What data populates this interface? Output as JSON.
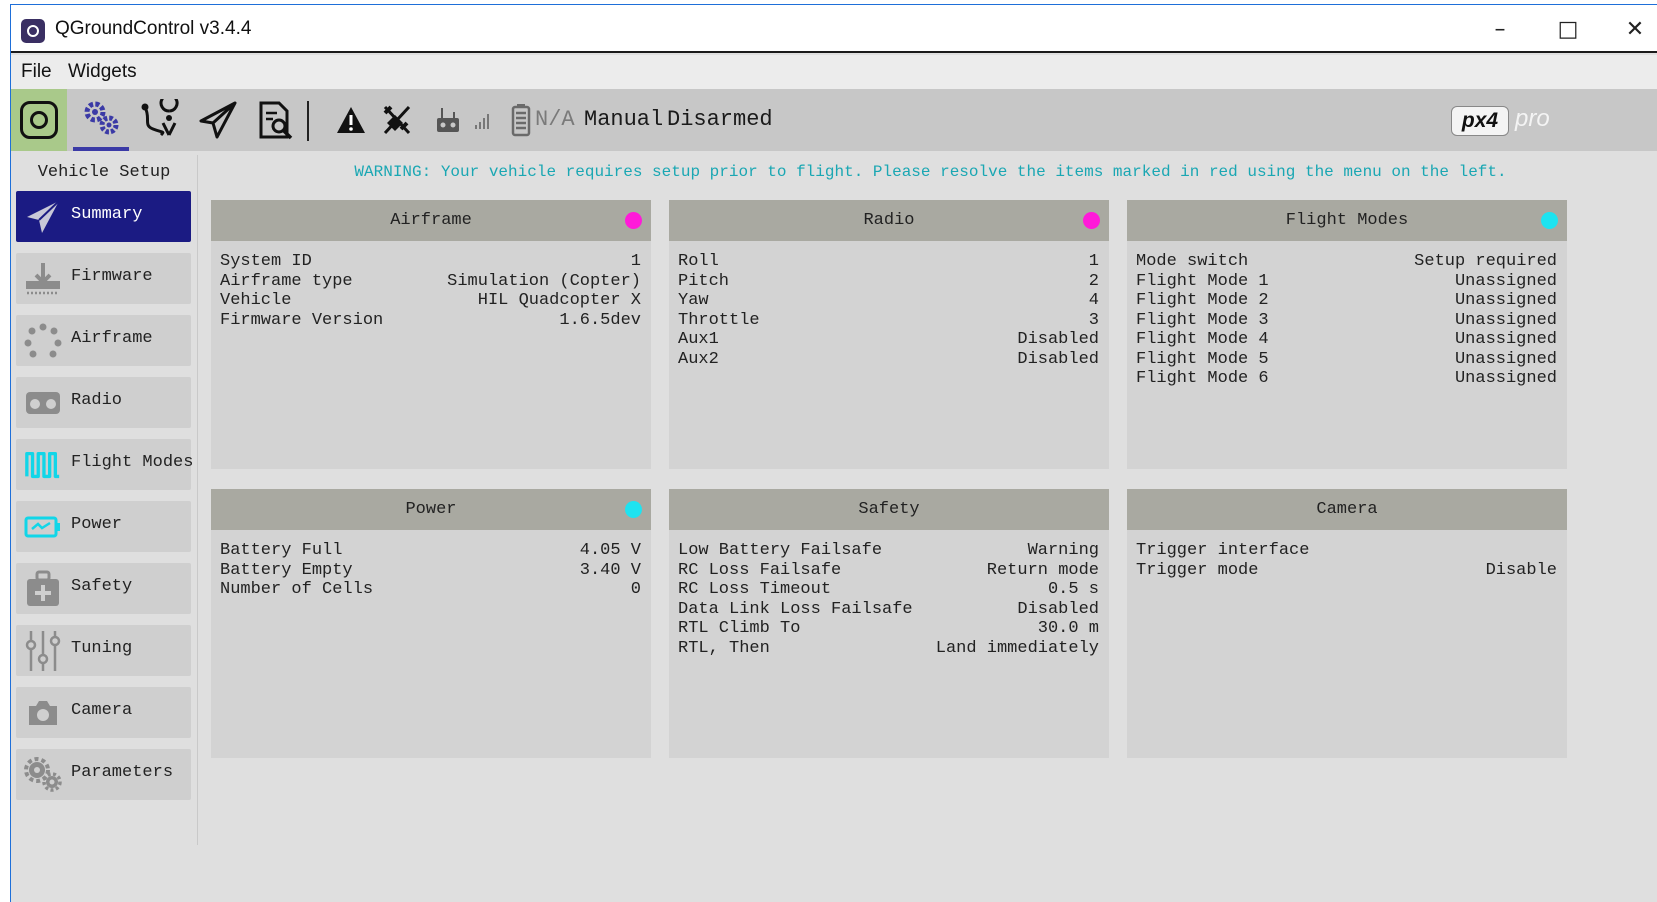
{
  "window": {
    "title": "QGroundControl v3.4.4",
    "controls": {
      "minimize": "–",
      "maximize": "□",
      "close": "✕"
    }
  },
  "menu": {
    "file": "File",
    "widgets": "Widgets"
  },
  "toolbar": {
    "buttons": [
      "qgc-logo-icon",
      "vehicle-setup-gears-icon",
      "plan-route-icon",
      "fly-paper-plane-icon",
      "analyze-document-icon"
    ],
    "status_icons": [
      "message-warning-icon",
      "gps-no-fix-icon",
      "rc-transmitter-icon",
      "rc-rssi-icon",
      "battery-icon"
    ],
    "battery": "N/A",
    "flight_mode": "Manual",
    "arm_state": "Disarmed",
    "brand": {
      "badge": "px4",
      "pro": "pro"
    }
  },
  "sidebar": {
    "title": "Vehicle Setup",
    "items": [
      {
        "label": "Summary",
        "icon": "paper-plane-icon",
        "active": true
      },
      {
        "label": "Firmware",
        "icon": "download-firmware-icon"
      },
      {
        "label": "Airframe",
        "icon": "airframe-dots-icon"
      },
      {
        "label": "Radio",
        "icon": "radio-transmitter-icon"
      },
      {
        "label": "Flight Modes",
        "icon": "flight-modes-wave-icon"
      },
      {
        "label": "Power",
        "icon": "power-battery-icon"
      },
      {
        "label": "Safety",
        "icon": "safety-medkit-icon"
      },
      {
        "label": "Tuning",
        "icon": "tuning-sliders-icon"
      },
      {
        "label": "Camera",
        "icon": "camera-icon"
      },
      {
        "label": "Parameters",
        "icon": "parameters-gears-icon"
      }
    ]
  },
  "warning": "WARNING: Your vehicle requires setup prior to flight. Please resolve the items marked in red using the menu on the left.",
  "colors": {
    "status_needs_setup": "#ff1ad9",
    "status_ok": "#1ee3f0",
    "active_item": "#1b1b83",
    "warning_text": "#1aa7b3",
    "panel_header": "#a9a9a1"
  },
  "panels": {
    "airframe": {
      "title": "Airframe",
      "status": "needs_setup",
      "rows": [
        {
          "label": "System ID",
          "value": "1"
        },
        {
          "label": "Airframe type",
          "value": "Simulation (Copter)"
        },
        {
          "label": "Vehicle",
          "value": "HIL Quadcopter X"
        },
        {
          "label": "Firmware Version",
          "value": "1.6.5dev"
        }
      ]
    },
    "radio": {
      "title": "Radio",
      "status": "needs_setup",
      "rows": [
        {
          "label": "Roll",
          "value": "1"
        },
        {
          "label": "Pitch",
          "value": "2"
        },
        {
          "label": "Yaw",
          "value": "4"
        },
        {
          "label": "Throttle",
          "value": "3"
        },
        {
          "label": "Aux1",
          "value": "Disabled"
        },
        {
          "label": "Aux2",
          "value": "Disabled"
        }
      ]
    },
    "flight_modes": {
      "title": "Flight Modes",
      "status": "ok",
      "rows": [
        {
          "label": "Mode switch",
          "value": "Setup required"
        },
        {
          "label": "Flight Mode 1",
          "value": "Unassigned"
        },
        {
          "label": "Flight Mode 2",
          "value": "Unassigned"
        },
        {
          "label": "Flight Mode 3",
          "value": "Unassigned"
        },
        {
          "label": "Flight Mode 4",
          "value": "Unassigned"
        },
        {
          "label": "Flight Mode 5",
          "value": "Unassigned"
        },
        {
          "label": "Flight Mode 6",
          "value": "Unassigned"
        }
      ]
    },
    "power": {
      "title": "Power",
      "status": "ok",
      "rows": [
        {
          "label": "Battery Full",
          "value": "4.05 V"
        },
        {
          "label": "Battery Empty",
          "value": "3.40 V"
        },
        {
          "label": "Number of Cells",
          "value": "0"
        }
      ]
    },
    "safety": {
      "title": "Safety",
      "status": "none",
      "rows": [
        {
          "label": "Low Battery Failsafe",
          "value": "Warning"
        },
        {
          "label": "RC Loss Failsafe",
          "value": "Return mode"
        },
        {
          "label": "RC Loss Timeout",
          "value": "0.5 s"
        },
        {
          "label": "Data Link Loss Failsafe",
          "value": "Disabled"
        },
        {
          "label": "RTL Climb To",
          "value": "30.0 m"
        },
        {
          "label": "RTL, Then",
          "value": "Land immediately"
        }
      ]
    },
    "camera": {
      "title": "Camera",
      "status": "none",
      "rows": [
        {
          "label": "Trigger interface",
          "value": ""
        },
        {
          "label": "Trigger mode",
          "value": "Disable"
        }
      ]
    }
  }
}
